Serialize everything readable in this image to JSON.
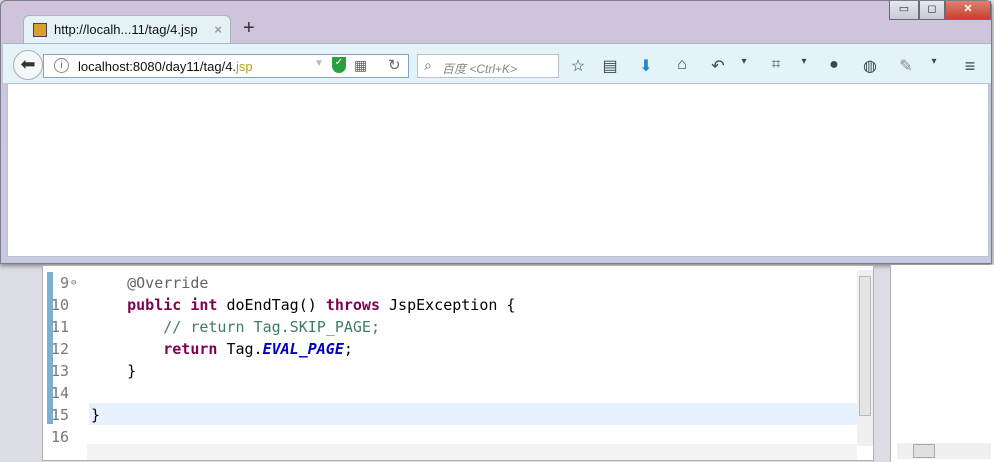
{
  "browser": {
    "tab_title": "http://localh...11/tag/4.jsp",
    "new_tab": "+",
    "url_main": "localhost:8080/day11/tag/4.",
    "url_ext": "jsp",
    "search_placeholder": "百度 <Ctrl+K>",
    "win_min": "▭",
    "win_max": "◻",
    "win_close": "✕"
  },
  "editor": {
    "lines": [
      {
        "num": "9",
        "fold": "⊖",
        "parts": [
          {
            "t": "    "
          },
          {
            "t": "@Override",
            "c": "an"
          }
        ]
      },
      {
        "num": "10",
        "parts": [
          {
            "t": "    "
          },
          {
            "t": "public",
            "c": "kw"
          },
          {
            "t": " "
          },
          {
            "t": "int",
            "c": "kw"
          },
          {
            "t": " doEndTag() "
          },
          {
            "t": "throws",
            "c": "kw"
          },
          {
            "t": " JspException {"
          }
        ]
      },
      {
        "num": "11",
        "parts": [
          {
            "t": "        "
          },
          {
            "t": "// return Tag.SKIP_PAGE;",
            "c": "cm"
          }
        ]
      },
      {
        "num": "12",
        "parts": [
          {
            "t": "        "
          },
          {
            "t": "return",
            "c": "kw"
          },
          {
            "t": " Tag."
          },
          {
            "t": "EVAL_PAGE",
            "c": "st"
          },
          {
            "t": ";"
          }
        ]
      },
      {
        "num": "13",
        "parts": [
          {
            "t": "    }"
          }
        ]
      },
      {
        "num": "14",
        "parts": []
      },
      {
        "num": "15",
        "parts": [
          {
            "t": "}"
          }
        ]
      },
      {
        "num": "16",
        "parts": []
      }
    ]
  }
}
